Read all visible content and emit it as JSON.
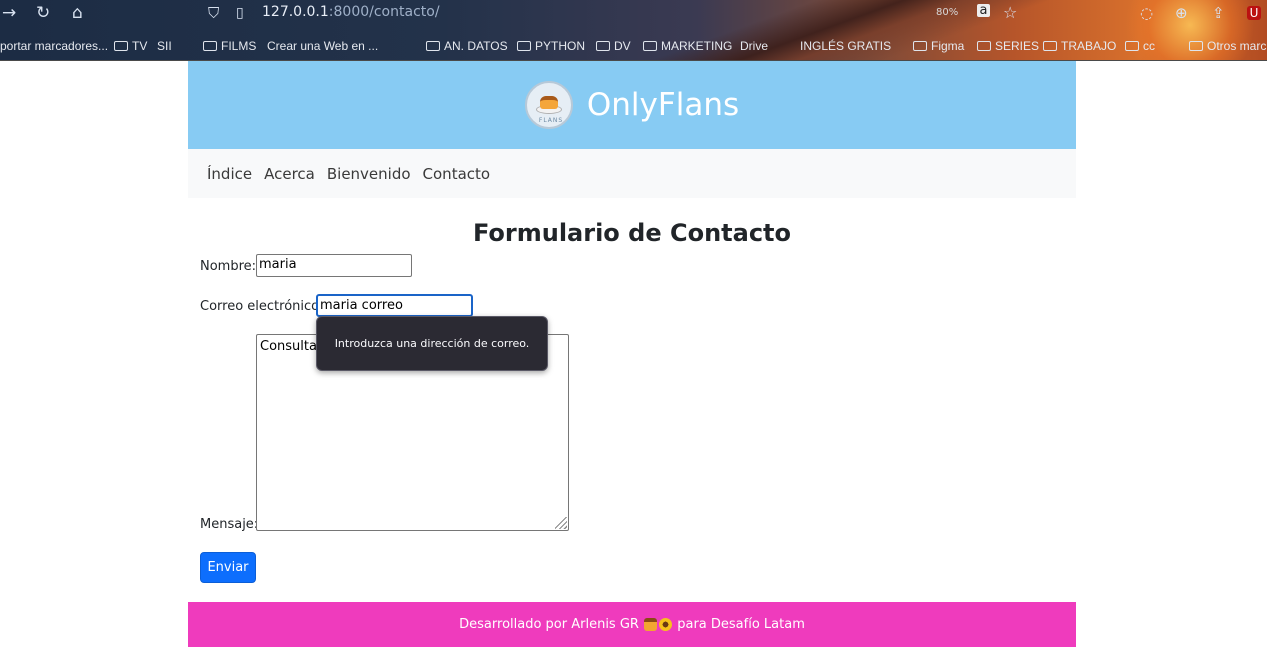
{
  "browser": {
    "url_host": "127.0.0.1",
    "url_path": ":8000/contacto/",
    "zoom": "80%",
    "bookmarks": [
      {
        "label": "portar marcadores...",
        "folder": false
      },
      {
        "label": "TV",
        "folder": true
      },
      {
        "label": "SII",
        "folder": false
      },
      {
        "label": "FILMS",
        "folder": true
      },
      {
        "label": "Crear una Web en ...",
        "folder": false
      },
      {
        "label": "AN. DATOS",
        "folder": true
      },
      {
        "label": "PYTHON",
        "folder": true
      },
      {
        "label": "DV",
        "folder": true
      },
      {
        "label": "MARKETING",
        "folder": true
      },
      {
        "label": "Drive",
        "folder": false
      },
      {
        "label": "INGLÉS GRATIS",
        "folder": false
      },
      {
        "label": "Figma",
        "folder": true
      },
      {
        "label": "SERIES",
        "folder": true
      },
      {
        "label": "TRABAJO",
        "folder": true
      },
      {
        "label": "cc",
        "folder": true
      },
      {
        "label": "Otros marc",
        "folder": true
      }
    ]
  },
  "header": {
    "brand": "OnlyFlans",
    "logo_text": "FLANS"
  },
  "menu": {
    "items": [
      "Índice",
      "Acerca",
      "Bienvenido",
      "Contacto"
    ]
  },
  "form": {
    "title": "Formulario de Contacto",
    "name_label": "Nombre:",
    "name_value": "maria",
    "email_label": "Correo electrónico:",
    "email_value": "maria correo",
    "message_label": "Mensaje:",
    "message_value": "Consulta s",
    "submit_label": "Enviar",
    "validation_tooltip": "Introduzca una dirección de correo."
  },
  "footer": {
    "text_before": "Desarrollado por Arlenis GR",
    "text_after": "para Desafío Latam"
  },
  "colors": {
    "header_bg": "#87cbf3",
    "menu_bg": "#f8f9fa",
    "button_bg": "#0d6efd",
    "footer_bg": "#ef3bbd",
    "tooltip_bg": "#2b2a33"
  }
}
